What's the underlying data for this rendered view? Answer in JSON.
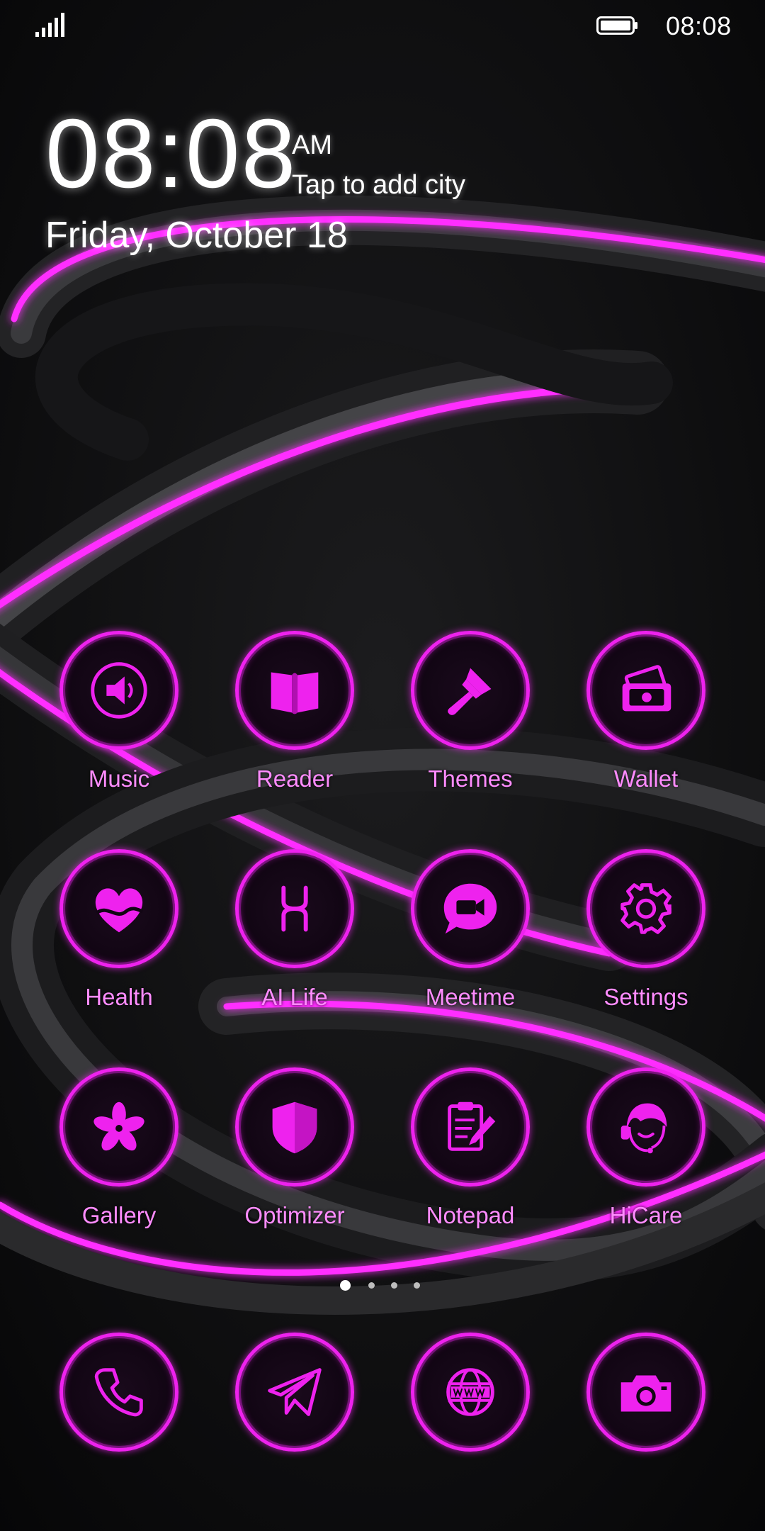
{
  "status_bar": {
    "signal_icon": "signal-bars-icon",
    "battery_icon": "battery-icon",
    "time": "08:08"
  },
  "clock_widget": {
    "time": "08:08",
    "ampm": "AM",
    "city": "Tap to add city",
    "date": "Friday, October 18"
  },
  "theme": {
    "accent": "#ee22ee",
    "label_color": "#ff8cff",
    "background": "#0b0b0c"
  },
  "apps": [
    {
      "label": "Music",
      "icon": "speaker-icon"
    },
    {
      "label": "Reader",
      "icon": "open-book-icon"
    },
    {
      "label": "Themes",
      "icon": "paintbrush-icon"
    },
    {
      "label": "Wallet",
      "icon": "wallet-icon"
    },
    {
      "label": "Health",
      "icon": "heart-icon"
    },
    {
      "label": "AI Life",
      "icon": "hilink-icon"
    },
    {
      "label": "Meetime",
      "icon": "video-chat-icon"
    },
    {
      "label": "Settings",
      "icon": "gear-icon"
    },
    {
      "label": "Gallery",
      "icon": "flower-icon"
    },
    {
      "label": "Optimizer",
      "icon": "shield-icon"
    },
    {
      "label": "Notepad",
      "icon": "clipboard-pen-icon"
    },
    {
      "label": "HiCare",
      "icon": "headset-icon"
    }
  ],
  "page_indicator": {
    "pages": 4,
    "current": 1
  },
  "dock": [
    {
      "icon": "phone-icon"
    },
    {
      "icon": "paper-plane-icon"
    },
    {
      "icon": "globe-www-icon"
    },
    {
      "icon": "camera-icon"
    }
  ]
}
